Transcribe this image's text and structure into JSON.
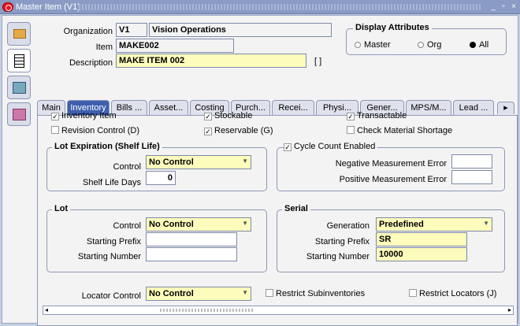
{
  "window": {
    "title": "Master Item (V1)"
  },
  "header": {
    "organization_label": "Organization",
    "organization_code": "V1",
    "organization_name": "Vision Operations",
    "item_label": "Item",
    "item_value": "MAKE002",
    "description_label": "Description",
    "description_value": "MAKE ITEM 002",
    "bracket": "[ ]"
  },
  "display_attributes": {
    "title": "Display Attributes",
    "options": [
      "Master",
      "Org",
      "All"
    ],
    "selected": "All"
  },
  "tabs": [
    "Main",
    "Inventory",
    "Bills ...",
    "Asset...",
    "Costing",
    "Purch...",
    "Recei...",
    "Physi...",
    "Gener...",
    "MPS/M...",
    "Lead ..."
  ],
  "active_tab": "Inventory",
  "checkboxes": {
    "inventory_item": {
      "label": "Inventory Item",
      "checked": true
    },
    "stockable": {
      "label": "Stockable",
      "checked": true
    },
    "transactable": {
      "label": "Transactable",
      "checked": true
    },
    "revision_control": {
      "label": "Revision Control (D)",
      "checked": false
    },
    "reservable": {
      "label": "Reservable (G)",
      "checked": true
    },
    "check_material_shortage": {
      "label": "Check Material Shortage",
      "checked": false
    },
    "cycle_count_enabled": {
      "label": "Cycle Count Enabled",
      "checked": true
    },
    "restrict_subinventories": {
      "label": "Restrict Subinventories",
      "checked": false
    },
    "restrict_locators": {
      "label": "Restrict Locators (J)",
      "checked": false
    }
  },
  "lot_expiration": {
    "title": "Lot Expiration (Shelf Life)",
    "control_label": "Control",
    "control_value": "No Control",
    "shelf_life_label": "Shelf Life Days",
    "shelf_life_value": "0"
  },
  "cycle_count": {
    "neg_label": "Negative Measurement Error",
    "neg_value": "",
    "pos_label": "Positive Measurement Error",
    "pos_value": ""
  },
  "lot": {
    "title": "Lot",
    "control_label": "Control",
    "control_value": "No Control",
    "prefix_label": "Starting Prefix",
    "prefix_value": "",
    "number_label": "Starting Number",
    "number_value": ""
  },
  "serial": {
    "title": "Serial",
    "generation_label": "Generation",
    "generation_value": "Predefined",
    "prefix_label": "Starting Prefix",
    "prefix_value": "SR",
    "number_label": "Starting Number",
    "number_value": "10000"
  },
  "locator": {
    "label": "Locator Control",
    "value": "No Control"
  }
}
